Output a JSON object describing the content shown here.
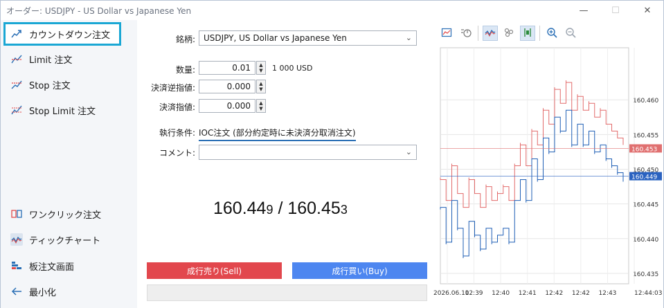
{
  "window": {
    "title": "オーダー: USDJPY - US Dollar vs Japanese Yen",
    "minimize_symbol": "—",
    "maximize_symbol": "☐",
    "close_symbol": "✕"
  },
  "sidebar": {
    "items": [
      {
        "label": "カウントダウン注文",
        "icon": "countdown-order-icon"
      },
      {
        "label": "Limit 注文",
        "icon": "limit-order-icon"
      },
      {
        "label": "Stop 注文",
        "icon": "stop-order-icon"
      },
      {
        "label": "Stop Limit 注文",
        "icon": "stop-limit-order-icon"
      }
    ],
    "bottom_items": [
      {
        "label": "ワンクリック注文",
        "icon": "one-click-order-icon"
      },
      {
        "label": "ティックチャート",
        "icon": "tick-chart-icon"
      },
      {
        "label": "板注文画面",
        "icon": "depth-of-market-icon"
      },
      {
        "label": "最小化",
        "icon": "arrow-left-icon"
      }
    ]
  },
  "form": {
    "symbol_label": "銘柄:",
    "symbol_value": "USDJPY, US Dollar vs Japanese Yen",
    "volume_label": "数量:",
    "volume_value": "0.01",
    "volume_unit": "1 000 USD",
    "sl_label": "決済逆指値:",
    "sl_value": "0.000",
    "tp_label": "決済指値:",
    "tp_value": "0.000",
    "execution_label": "執行条件:",
    "execution_value": "IOC注文 (部分約定時に未決済分取消注文)",
    "comment_label": "コメント:",
    "comment_value": ""
  },
  "quote": {
    "bid_main": "160.44",
    "bid_small": "9",
    "separator": "/",
    "ask_main": "160.45",
    "ask_small": "3"
  },
  "buttons": {
    "sell_label": "成行売り(Sell)",
    "buy_label": "成行買い(Buy)"
  },
  "chart_toolbar": [
    "chart-settings-icon",
    "tick-stats-icon",
    "tick-line-icon",
    "tick-points-icon",
    "bid-ask-icon",
    "zoom-in-icon",
    "zoom-out-icon"
  ],
  "colors": {
    "ask_line": "#e26a6a",
    "bid_line": "#1f5fb5",
    "ask_badge": "#e07070",
    "bid_badge": "#2a62c0",
    "highlight": "#1aa7d4",
    "sell": "#e2474d",
    "buy": "#4d86f0"
  },
  "chart_data": {
    "type": "line",
    "ylim": [
      160.4335,
      160.4675
    ],
    "y_ticks": [
      "160.460",
      "160.455",
      "160.450",
      "160.445",
      "160.440",
      "160.435"
    ],
    "x_ticks": [
      "2026.06.10",
      "12:39",
      "12:40",
      "12:41",
      "12:42",
      "12:42",
      "12:43",
      "12:44:03"
    ],
    "ask_badge": "160.453",
    "bid_badge": "160.449",
    "grid": true,
    "series": [
      {
        "values": [
          160.4485,
          160.4455,
          160.4505,
          160.4465,
          160.4445,
          160.4485,
          160.4465,
          160.4445,
          160.4475,
          160.4455,
          160.4465,
          160.4475,
          160.4455,
          160.4505,
          160.4535,
          160.4505,
          160.4555,
          160.4535,
          160.4585,
          160.4565,
          160.4615,
          160.4595,
          160.4625,
          160.4585,
          160.4605,
          160.4585,
          160.4595,
          160.4575,
          160.4585,
          160.4565,
          160.4555,
          160.4545,
          160.4535
        ]
      },
      {
        "values": [
          160.4445,
          160.4395,
          160.4455,
          160.4415,
          160.4375,
          160.4425,
          160.4405,
          160.4385,
          160.4415,
          160.4395,
          160.4405,
          160.4415,
          160.4395,
          160.4455,
          160.4485,
          160.4455,
          160.4515,
          160.4485,
          160.4545,
          160.4525,
          160.4575,
          160.4555,
          160.4585,
          160.4535,
          160.4565,
          160.4535,
          160.4555,
          160.4525,
          160.4535,
          160.4515,
          160.4505,
          160.4495,
          160.4485
        ]
      }
    ]
  }
}
